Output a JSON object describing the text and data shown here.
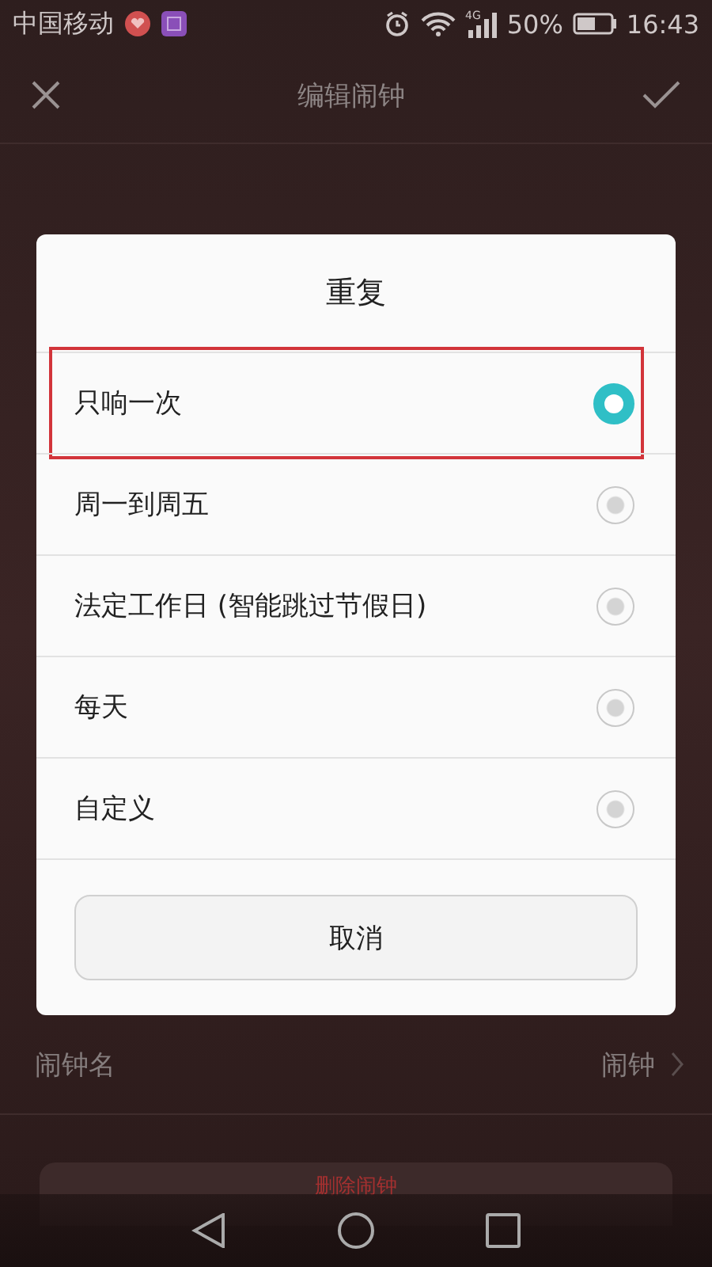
{
  "status_bar": {
    "carrier": "中国移动",
    "battery": "50%",
    "time": "16:43",
    "network": "4G"
  },
  "header": {
    "title": "编辑闹钟"
  },
  "background_rows": [
    {
      "label": "闹钟名",
      "value": "闹钟"
    }
  ],
  "delete_button": {
    "label": "删除闹钟"
  },
  "dialog": {
    "title": "重复",
    "options": [
      {
        "label": "只响一次",
        "selected": true,
        "highlighted": true
      },
      {
        "label": "周一到周五",
        "selected": false,
        "highlighted": false
      },
      {
        "label": "法定工作日 (智能跳过节假日)",
        "selected": false,
        "highlighted": false
      },
      {
        "label": "每天",
        "selected": false,
        "highlighted": false
      },
      {
        "label": "自定义",
        "selected": false,
        "highlighted": false
      }
    ],
    "cancel": "取消"
  }
}
